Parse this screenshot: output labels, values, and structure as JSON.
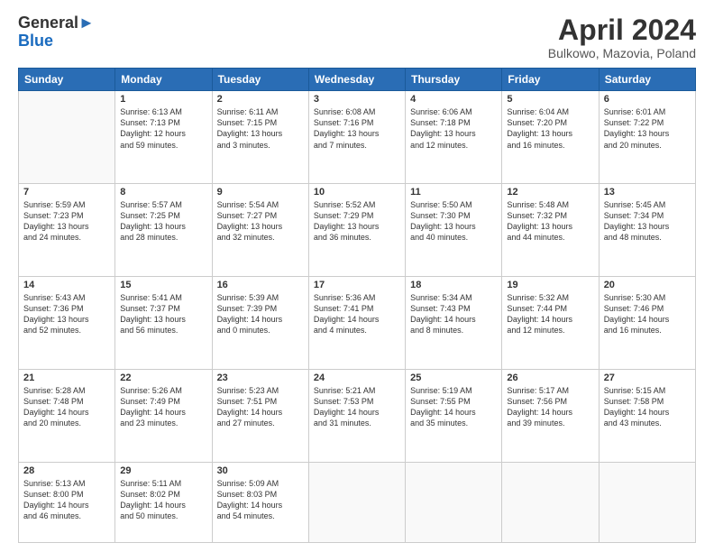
{
  "header": {
    "logo_general": "General",
    "logo_blue": "Blue",
    "title": "April 2024",
    "subtitle": "Bulkowo, Mazovia, Poland"
  },
  "weekdays": [
    "Sunday",
    "Monday",
    "Tuesday",
    "Wednesday",
    "Thursday",
    "Friday",
    "Saturday"
  ],
  "weeks": [
    [
      {
        "day": "",
        "info": ""
      },
      {
        "day": "1",
        "info": "Sunrise: 6:13 AM\nSunset: 7:13 PM\nDaylight: 12 hours\nand 59 minutes."
      },
      {
        "day": "2",
        "info": "Sunrise: 6:11 AM\nSunset: 7:15 PM\nDaylight: 13 hours\nand 3 minutes."
      },
      {
        "day": "3",
        "info": "Sunrise: 6:08 AM\nSunset: 7:16 PM\nDaylight: 13 hours\nand 7 minutes."
      },
      {
        "day": "4",
        "info": "Sunrise: 6:06 AM\nSunset: 7:18 PM\nDaylight: 13 hours\nand 12 minutes."
      },
      {
        "day": "5",
        "info": "Sunrise: 6:04 AM\nSunset: 7:20 PM\nDaylight: 13 hours\nand 16 minutes."
      },
      {
        "day": "6",
        "info": "Sunrise: 6:01 AM\nSunset: 7:22 PM\nDaylight: 13 hours\nand 20 minutes."
      }
    ],
    [
      {
        "day": "7",
        "info": "Sunrise: 5:59 AM\nSunset: 7:23 PM\nDaylight: 13 hours\nand 24 minutes."
      },
      {
        "day": "8",
        "info": "Sunrise: 5:57 AM\nSunset: 7:25 PM\nDaylight: 13 hours\nand 28 minutes."
      },
      {
        "day": "9",
        "info": "Sunrise: 5:54 AM\nSunset: 7:27 PM\nDaylight: 13 hours\nand 32 minutes."
      },
      {
        "day": "10",
        "info": "Sunrise: 5:52 AM\nSunset: 7:29 PM\nDaylight: 13 hours\nand 36 minutes."
      },
      {
        "day": "11",
        "info": "Sunrise: 5:50 AM\nSunset: 7:30 PM\nDaylight: 13 hours\nand 40 minutes."
      },
      {
        "day": "12",
        "info": "Sunrise: 5:48 AM\nSunset: 7:32 PM\nDaylight: 13 hours\nand 44 minutes."
      },
      {
        "day": "13",
        "info": "Sunrise: 5:45 AM\nSunset: 7:34 PM\nDaylight: 13 hours\nand 48 minutes."
      }
    ],
    [
      {
        "day": "14",
        "info": "Sunrise: 5:43 AM\nSunset: 7:36 PM\nDaylight: 13 hours\nand 52 minutes."
      },
      {
        "day": "15",
        "info": "Sunrise: 5:41 AM\nSunset: 7:37 PM\nDaylight: 13 hours\nand 56 minutes."
      },
      {
        "day": "16",
        "info": "Sunrise: 5:39 AM\nSunset: 7:39 PM\nDaylight: 14 hours\nand 0 minutes."
      },
      {
        "day": "17",
        "info": "Sunrise: 5:36 AM\nSunset: 7:41 PM\nDaylight: 14 hours\nand 4 minutes."
      },
      {
        "day": "18",
        "info": "Sunrise: 5:34 AM\nSunset: 7:43 PM\nDaylight: 14 hours\nand 8 minutes."
      },
      {
        "day": "19",
        "info": "Sunrise: 5:32 AM\nSunset: 7:44 PM\nDaylight: 14 hours\nand 12 minutes."
      },
      {
        "day": "20",
        "info": "Sunrise: 5:30 AM\nSunset: 7:46 PM\nDaylight: 14 hours\nand 16 minutes."
      }
    ],
    [
      {
        "day": "21",
        "info": "Sunrise: 5:28 AM\nSunset: 7:48 PM\nDaylight: 14 hours\nand 20 minutes."
      },
      {
        "day": "22",
        "info": "Sunrise: 5:26 AM\nSunset: 7:49 PM\nDaylight: 14 hours\nand 23 minutes."
      },
      {
        "day": "23",
        "info": "Sunrise: 5:23 AM\nSunset: 7:51 PM\nDaylight: 14 hours\nand 27 minutes."
      },
      {
        "day": "24",
        "info": "Sunrise: 5:21 AM\nSunset: 7:53 PM\nDaylight: 14 hours\nand 31 minutes."
      },
      {
        "day": "25",
        "info": "Sunrise: 5:19 AM\nSunset: 7:55 PM\nDaylight: 14 hours\nand 35 minutes."
      },
      {
        "day": "26",
        "info": "Sunrise: 5:17 AM\nSunset: 7:56 PM\nDaylight: 14 hours\nand 39 minutes."
      },
      {
        "day": "27",
        "info": "Sunrise: 5:15 AM\nSunset: 7:58 PM\nDaylight: 14 hours\nand 43 minutes."
      }
    ],
    [
      {
        "day": "28",
        "info": "Sunrise: 5:13 AM\nSunset: 8:00 PM\nDaylight: 14 hours\nand 46 minutes."
      },
      {
        "day": "29",
        "info": "Sunrise: 5:11 AM\nSunset: 8:02 PM\nDaylight: 14 hours\nand 50 minutes."
      },
      {
        "day": "30",
        "info": "Sunrise: 5:09 AM\nSunset: 8:03 PM\nDaylight: 14 hours\nand 54 minutes."
      },
      {
        "day": "",
        "info": ""
      },
      {
        "day": "",
        "info": ""
      },
      {
        "day": "",
        "info": ""
      },
      {
        "day": "",
        "info": ""
      }
    ]
  ]
}
